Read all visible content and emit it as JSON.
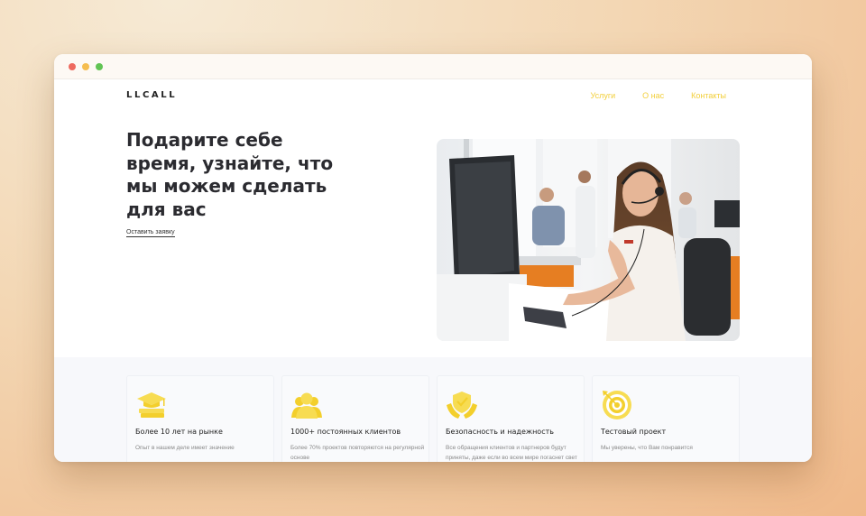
{
  "window": {
    "controls": [
      "close",
      "minimize",
      "maximize"
    ]
  },
  "navbar": {
    "logo": "LLCALL",
    "links": [
      "Услуги",
      "О нас",
      "Контакты"
    ],
    "link_color": "#f2cf3b"
  },
  "hero": {
    "title": "Подарите себе время, узнайте, что мы можем сделать для вас",
    "cta": "Оставить заявку",
    "image": "call-center-operator-photo"
  },
  "features": [
    {
      "icon": "graduation-cap-books-icon",
      "title": "Более 10 лет на рынке",
      "desc": "Опыт в нашем деле имеет значение"
    },
    {
      "icon": "people-group-icon",
      "title": "1000+ постоянных клиентов",
      "desc": "Более 70% проектов повторяются на регулярной основе"
    },
    {
      "icon": "shield-hands-icon",
      "title": "Безопасность и надежность",
      "desc": "Все обращения клиентов и партнеров будут приняты, даже если во всем мире погаснет свет"
    },
    {
      "icon": "target-icon",
      "title": "Тестовый проект",
      "desc": "Мы уверены, что Вам понравится"
    }
  ],
  "colors": {
    "accent": "#f2cf3b",
    "icon_yellow": "#f7dc52"
  }
}
